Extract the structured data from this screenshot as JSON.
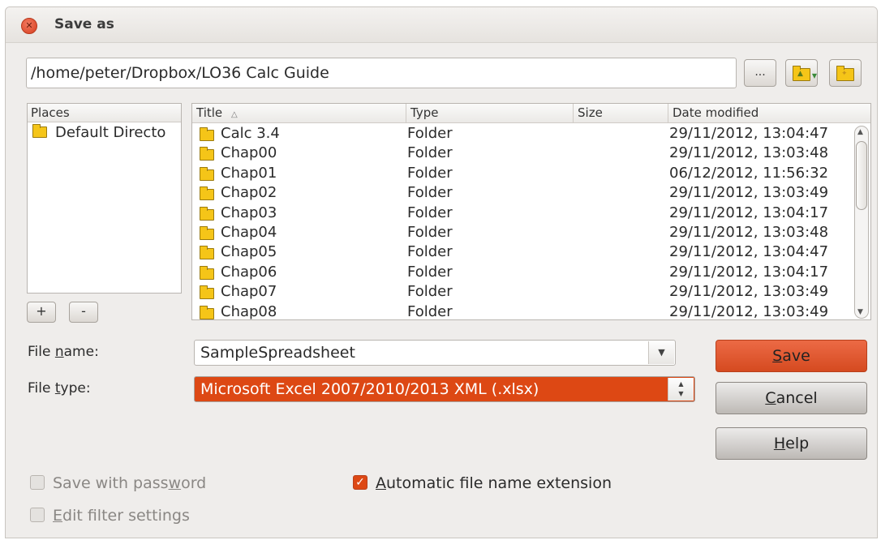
{
  "dialog": {
    "title": "Save as",
    "path": "/home/peter/Dropbox/LO36 Calc Guide",
    "browse_label": "...",
    "icons": [
      "close-icon",
      "folder-up-icon",
      "new-folder-icon",
      "folder-icon",
      "sort-ascending-icon",
      "chevron-down-icon",
      "check-icon"
    ]
  },
  "places": {
    "header": "Places",
    "items": [
      "Default Directo"
    ],
    "add_label": "+",
    "remove_label": "-"
  },
  "files": {
    "columns": {
      "title": "Title",
      "sort_indicator": "△",
      "type": "Type",
      "size": "Size",
      "date": "Date modified"
    },
    "rows": [
      {
        "title": "Calc 3.4",
        "type": "Folder",
        "size": "",
        "date": "29/11/2012, 13:04:47"
      },
      {
        "title": "Chap00",
        "type": "Folder",
        "size": "",
        "date": "29/11/2012, 13:03:48"
      },
      {
        "title": "Chap01",
        "type": "Folder",
        "size": "",
        "date": "06/12/2012, 11:56:32"
      },
      {
        "title": "Chap02",
        "type": "Folder",
        "size": "",
        "date": "29/11/2012, 13:03:49"
      },
      {
        "title": "Chap03",
        "type": "Folder",
        "size": "",
        "date": "29/11/2012, 13:04:17"
      },
      {
        "title": "Chap04",
        "type": "Folder",
        "size": "",
        "date": "29/11/2012, 13:03:48"
      },
      {
        "title": "Chap05",
        "type": "Folder",
        "size": "",
        "date": "29/11/2012, 13:04:47"
      },
      {
        "title": "Chap06",
        "type": "Folder",
        "size": "",
        "date": "29/11/2012, 13:04:17"
      },
      {
        "title": "Chap07",
        "type": "Folder",
        "size": "",
        "date": "29/11/2012, 13:03:49"
      },
      {
        "title": "Chap08",
        "type": "Folder",
        "size": "",
        "date": "29/11/2012, 13:03:49"
      }
    ]
  },
  "form": {
    "file_name_label": {
      "pre": "File ",
      "key": "n",
      "post": "ame:"
    },
    "file_name_value": "SampleSpreadsheet",
    "file_type_label": {
      "pre": "File ",
      "key": "t",
      "post": "ype:"
    },
    "file_type_value": "Microsoft Excel 2007/2010/2013 XML (.xlsx)"
  },
  "buttons": {
    "save": {
      "key": "S",
      "rest": "ave"
    },
    "cancel": {
      "key": "C",
      "rest": "ancel"
    },
    "help": {
      "key": "H",
      "rest": "elp"
    }
  },
  "options": {
    "save_with_password": {
      "pre": "Save with pass",
      "key": "w",
      "post": "ord",
      "checked": false,
      "enabled": false
    },
    "auto_extension": {
      "pre": "",
      "key": "A",
      "post": "utomatic file name extension",
      "checked": true,
      "enabled": true
    },
    "edit_filter": {
      "pre": "",
      "key": "E",
      "post": "dit filter settings",
      "checked": false,
      "enabled": false
    }
  },
  "colors": {
    "accent": "#dd4814",
    "dialog_bg": "#efedeb"
  }
}
